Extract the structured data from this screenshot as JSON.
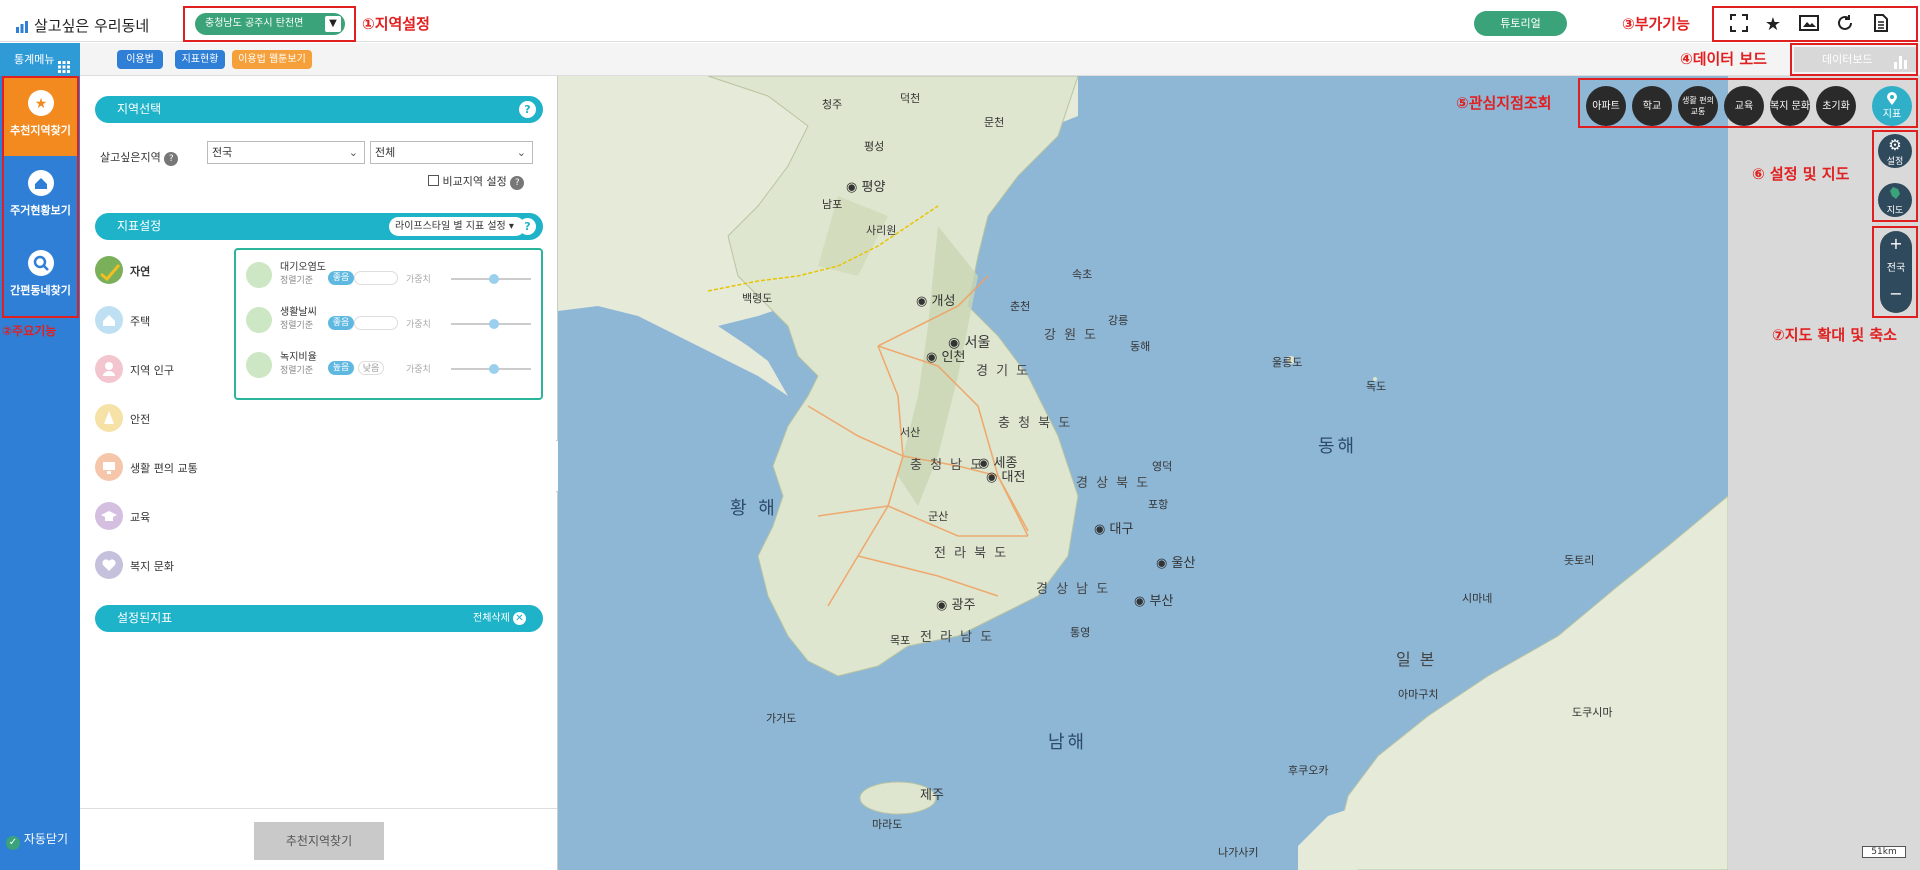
{
  "header": {
    "app_title": "살고싶은 우리동네",
    "region_selected": "충청남도 공주시 탄천면",
    "annot_region": "①지역설정",
    "tutorial_label": "튜토리얼",
    "annot_tools": "③부가기능",
    "tool_icons": [
      "fullscreen-icon",
      "star-icon",
      "image-icon",
      "refresh-icon",
      "document-icon"
    ]
  },
  "subbar": {
    "stat_menu_label": "통계메뉴",
    "chips": [
      "이용법",
      "지표현황",
      "이용법 웹툰보기"
    ],
    "annot_databoard": "④데이터 보드",
    "databoard_label": "데이터보드"
  },
  "leftnav": {
    "items": [
      "추천지역찾기",
      "주거현황보기",
      "간편동네찾기"
    ],
    "annot_main": "②주요기능",
    "autoclose_label": "자동닫기"
  },
  "panel": {
    "region_section": {
      "title": "지역선택",
      "field_label": "살고싶은지역",
      "select1": "전국",
      "select2": "전체",
      "compare_label": "비교지역 설정"
    },
    "indicator_section": {
      "title": "지표설정",
      "dropdown_label": "라이프스타일 별 지표 설정",
      "items": [
        "자연",
        "주택",
        "지역 인구",
        "안전",
        "생활 편의 교통",
        "교육",
        "복지 문화"
      ],
      "details": [
        {
          "title": "대기오염도",
          "criteria_label": "정렬기준",
          "pills": [
            "좋음"
          ],
          "weight_label": "가중치"
        },
        {
          "title": "생활날씨",
          "criteria_label": "정렬기준",
          "pills": [
            "좋음"
          ],
          "weight_label": "가중치"
        },
        {
          "title": "녹지비율",
          "criteria_label": "정렬기준",
          "pills": [
            "높음",
            "낮음"
          ],
          "weight_label": "가중치"
        }
      ]
    },
    "set_section": {
      "title": "설정된지표",
      "clear_all_label": "전체삭제"
    },
    "recommend_button": "추천지역찾기"
  },
  "map": {
    "seas": [
      "황 해",
      "동해",
      "남해"
    ],
    "provinces": [
      "강 원 도",
      "경 기 도",
      "충 청 북 도",
      "충 청 남 도",
      "경 상 북 도",
      "전 라 북 도",
      "경 상 남 도",
      "전 라 남 도",
      "일 본"
    ],
    "cities": [
      "평양",
      "개성",
      "서울",
      "인천",
      "세종",
      "대전",
      "대구",
      "울산",
      "광주",
      "부산",
      "제주"
    ],
    "places": [
      "청주",
      "덕천",
      "문천",
      "평성",
      "남포",
      "사리원",
      "백령도",
      "춘천",
      "속초",
      "강릉",
      "동해",
      "울릉도",
      "독도",
      "서산",
      "영덕",
      "포항",
      "군산",
      "목포",
      "통영",
      "마라도",
      "가거도",
      "돗토리",
      "시마네",
      "아마구치",
      "도쿠시마",
      "후쿠오카",
      "나가사키"
    ],
    "scale_label": "51km"
  },
  "right": {
    "annot_poi": "⑤관심지점조회",
    "poi_buttons": [
      "아파트",
      "학교",
      "생활 편의 교통",
      "교육",
      "복지 문화",
      "초기화"
    ],
    "poi_indicator_label": "지표",
    "annot_settings": "⑥ 설정 및 지도",
    "settings_label": "설정",
    "map_label": "지도",
    "annot_zoom": "⑦지도 확대 및 축소",
    "zoom_in": "+",
    "zoom_mid_label": "전국",
    "zoom_out": "−"
  },
  "colors": {
    "accent_green": "#3aa37a",
    "nav_blue": "#2f7fd6",
    "nav_active": "#f28a1f",
    "section_teal": "#1fb3c9",
    "annotation_red": "#e02020"
  }
}
